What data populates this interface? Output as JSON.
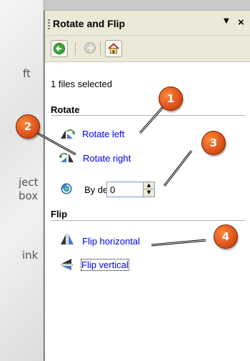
{
  "background_fragments": [
    "ft",
    "ject",
    "box",
    "ink"
  ],
  "pane": {
    "title": "Rotate and Flip",
    "dropdown_icon": "▼",
    "close_icon": "×"
  },
  "status": "1 files selected",
  "rotate": {
    "heading": "Rotate",
    "rotate_left": "Rotate left",
    "rotate_right": "Rotate right",
    "by_degree_label": "By degree:",
    "by_degree_value": "0"
  },
  "flip": {
    "heading": "Flip",
    "horizontal": "Flip horizontal",
    "vertical": "Flip vertical"
  },
  "callouts": [
    "1",
    "2",
    "3",
    "4"
  ],
  "colors": {
    "link": "#0000ee",
    "callout": "#e0551d",
    "pane_header": "#ece9d8"
  }
}
